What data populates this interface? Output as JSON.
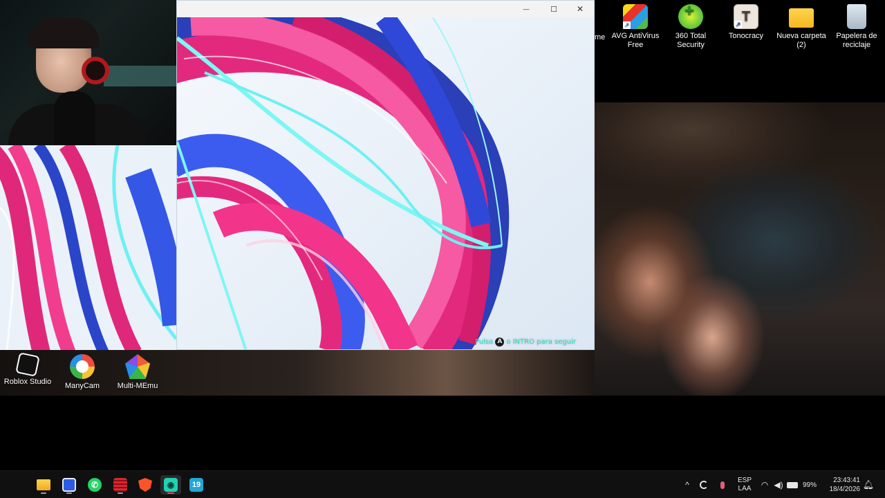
{
  "desktop": {
    "top_icons": [
      {
        "label": "AVG AntiVirus Free",
        "icon": "avg-antivirus-icon"
      },
      {
        "label": "360 Total Security",
        "icon": "360-total-security-icon"
      },
      {
        "label": "Tonocracy",
        "icon": "tonocracy-icon"
      },
      {
        "label": "Nueva carpeta (2)",
        "icon": "folder-icon"
      },
      {
        "label": "Papelera de reciclaje",
        "icon": "recycle-bin-icon"
      }
    ],
    "partial_icon_label": "me",
    "bottom_icons": [
      {
        "label": "Roblox Studio",
        "icon": "roblox-studio-icon"
      },
      {
        "label": "ManyCam",
        "icon": "manycam-icon"
      },
      {
        "label": "Multi-MEmu",
        "icon": "multi-memu-icon"
      }
    ]
  },
  "game_window": {
    "minimize_glyph": "—",
    "maximize_glyph": "☐",
    "close_glyph": "✕",
    "press_hint": {
      "prefix": "Pulsa",
      "button_glyph": "A",
      "suffix": "o INTRO para seguir"
    }
  },
  "taskbar": {
    "apps": [
      {
        "name": "start-button",
        "glyph": "⊞",
        "color": "#3a8ee6",
        "active": false
      },
      {
        "name": "file-explorer",
        "glyph": "▬",
        "color": "#f2b632",
        "active": false
      },
      {
        "name": "app-blue",
        "glyph": "◆",
        "color": "#2d5be3",
        "active": false
      },
      {
        "name": "whatsapp",
        "glyph": "✆",
        "color": "#25d366",
        "active": false
      },
      {
        "name": "app-red",
        "glyph": "▤",
        "color": "#d8282e",
        "active": false
      },
      {
        "name": "brave",
        "glyph": "🛡",
        "color": "#fb542b",
        "active": false
      },
      {
        "name": "app-emulator",
        "glyph": "◉",
        "color": "#1fd3b0",
        "active": true
      },
      {
        "name": "app-19",
        "glyph": "19",
        "color": "#22a6d8",
        "active": false
      }
    ],
    "tray": {
      "chevron": "^",
      "lang_top": "ESP",
      "lang_bottom": "LAA",
      "battery_percent": "99%",
      "time": "23:43:41",
      "date": "18/4/2026"
    }
  }
}
